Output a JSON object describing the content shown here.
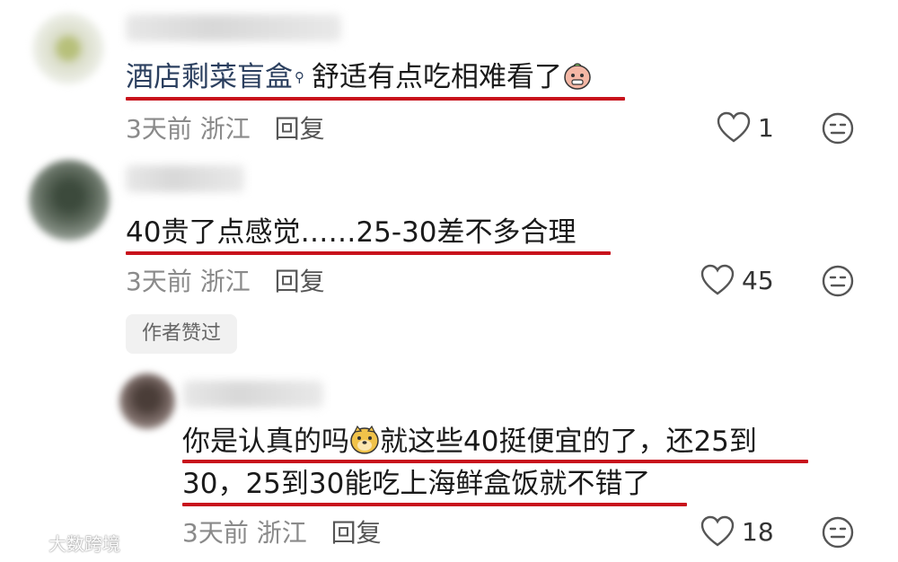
{
  "comments": [
    {
      "text_link": "酒店剩菜盲盒",
      "text": "舒适有点吃相难看了",
      "emoji_icon": "grimace-peach-emoji",
      "time": "3天前",
      "location": "浙江",
      "reply_label": "回复",
      "likes": "1"
    },
    {
      "text": "40贵了点感觉……25-30差不多合理",
      "time": "3天前",
      "location": "浙江",
      "reply_label": "回复",
      "likes": "45",
      "author_tag": "作者赞过"
    }
  ],
  "reply": {
    "line1_a": "你是认真的吗",
    "emoji_icon": "doge-emoji",
    "line1_b": "就这些40挺便宜的了，还25到",
    "line2": "30，25到30能吃上海鲜盒饭就不错了",
    "time": "3天前",
    "location": "浙江",
    "reply_label": "回复",
    "likes": "18"
  },
  "watermark": {
    "text": "大数跨境"
  },
  "colors": {
    "underline": "#c8121c",
    "link": "#2b3f5f",
    "meta": "#8a8a8a"
  }
}
